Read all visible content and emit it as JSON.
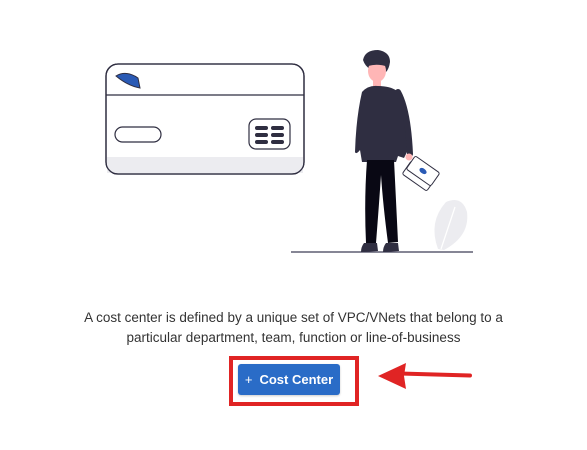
{
  "empty_state": {
    "description_line1": "A cost center is defined by a unique set of VPC/VNets that belong to a",
    "description_line2": "particular department, team, function or line-of-business"
  },
  "add_button": {
    "icon_text": "+",
    "label": "Cost Center",
    "icon": "plus-icon"
  },
  "annotation": {
    "highlight_color": "#e02424",
    "arrow_icon": "arrow-left-icon"
  },
  "colors": {
    "button": "#2a6cc7",
    "illustration_dark": "#2f2e41",
    "illustration_accent": "#2a5ab5"
  }
}
